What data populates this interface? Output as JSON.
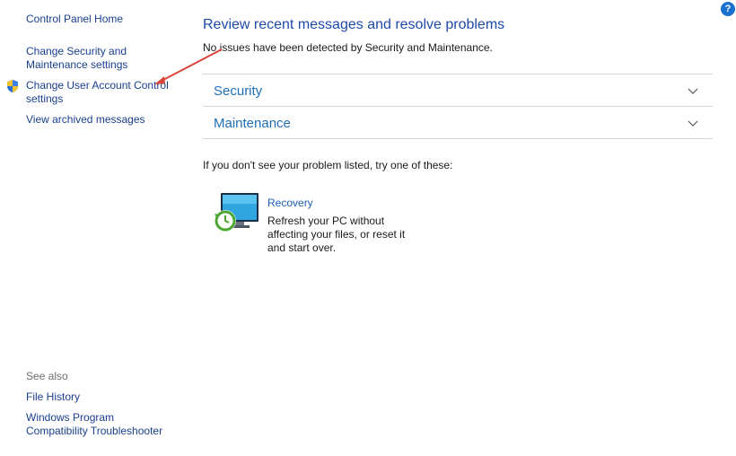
{
  "sidebar": {
    "home": "Control Panel Home",
    "change_security": "Change Security and Maintenance settings",
    "change_uac": "Change User Account Control settings",
    "view_archived": "View archived messages",
    "see_also_label": "See also",
    "file_history": "File History",
    "compat_troubleshooter": "Windows Program Compatibility Troubleshooter"
  },
  "main": {
    "title": "Review recent messages and resolve problems",
    "status": "No issues have been detected by Security and Maintenance.",
    "sections": [
      {
        "label": "Security"
      },
      {
        "label": "Maintenance"
      }
    ],
    "hint": "If you don't see your problem listed, try one of these:",
    "recovery": {
      "link": "Recovery",
      "description": "Refresh your PC without affecting your files, or reset it and start over."
    }
  },
  "help": {
    "label": "?"
  },
  "colors": {
    "link": "#1a3f8f",
    "title": "#1e4aa8",
    "section": "#1e6fb8",
    "annotation_arrow": "#d9443a"
  },
  "icons": [
    "uac-shield-icon",
    "chevron-down-icon",
    "recovery-monitor-icon",
    "help-icon"
  ]
}
